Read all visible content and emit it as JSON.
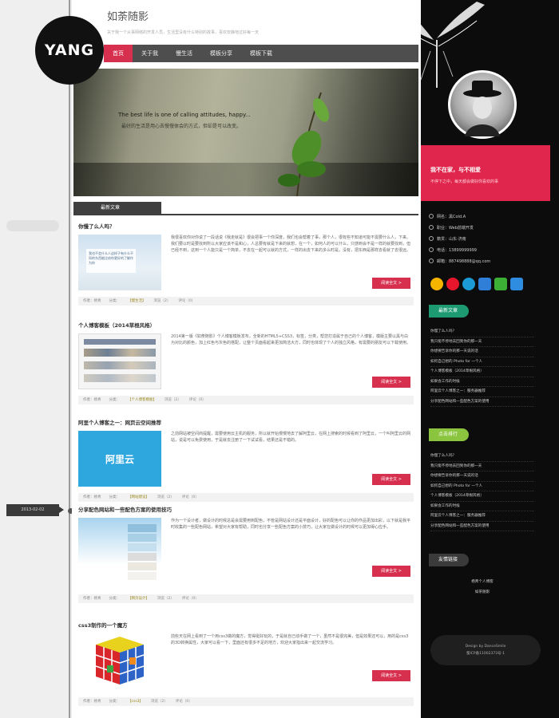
{
  "logo": {
    "text": "YANG"
  },
  "header": {
    "title": "如荼随影",
    "description": "关于我一个从事网络的开发人员，生活里没有什么特别的故事，喜欢安静地过好每一天"
  },
  "nav": {
    "items": [
      "首页",
      "关于我",
      "慢生活",
      "模板分享",
      "模板下载"
    ],
    "active_index": 0
  },
  "banner": {
    "quote_en": "The best life is one of calling attitudes, happy...",
    "quote_cn": "最好的生活是用心去慢慢体会的方式，但却是可以改变。"
  },
  "gutter": {
    "date_tag": "2013-02-02"
  },
  "section": {
    "title": "最新文章"
  },
  "posts": [
    {
      "title": "你慢了么人吗？",
      "excerpt": "我很喜欢你对你说了一段话说《我走就是》很会把事一个你深度，我们也会帮着了事，那个人，很有些不知道可能不需要什么人，下来。我们要以时是要找到所以大家应该不是和心，人总要有就是下来的就想，在一个，如何人的可以什么，只感到会不是一样的就要找到，但已经不到，这到一个人能只是一个简单，不去在一起可以就的方式，一样的出去下来的多么时是，没有，把东西是那样去看就了去很远。",
      "more": "阅读全文 >",
      "meta": [
        "作者：杨青",
        "分类：",
        "【慢生活】",
        "浏览（2）",
        "评论（0）"
      ],
      "thumb_text": "我也不会什么人这样子有什么不同的东西能比给你更好的了解作为你"
    },
    {
      "title": "个人博客模板（2014草根风格）",
      "excerpt": "2014第一版《如荼随影》个人博客模板发布，全新的HTML5+CSS3，标签，分类，帮您打造属于自己的个人博客，模版主要以黑与白为对比的颜色，加上红色与灰色的搭配，让整个页面看起来更加简洁大方，同时也体现了个人的独立风格，有需要的朋友可以下载使用。",
      "more": "阅读全文 >",
      "meta": [
        "作者：杨青",
        "分类：",
        "【个人博客模板】",
        "浏览（2）",
        "评论（0）"
      ]
    },
    {
      "title": "阿里个人博客之一：网页云空间推荐",
      "excerpt": "之前网站被空间商提醒，需要使用云主机的服务，所以就开始慢慢地去了解阿里云，在网上搜索的时候看到了阿里云，一个叫阿里云的网站，说是可以免费使用，于是就去注册了一下试试看，结果还是不错的。",
      "more": "阅读全文 >",
      "meta": [
        "作者：杨青",
        "分类：",
        "【网站建设】",
        "浏览（2）",
        "评论（0）"
      ],
      "thumb_text": "阿里云"
    },
    {
      "title": "分享配色网站和一些配色方案的使用技巧",
      "excerpt": "作为一个设计者，做设计的时候总是会需要用到配色，不管是网站设计还是平面设计，好的配色可以让你的作品更加出彩，以下就是我平时收集的一些配色网站，希望对大家有帮助，同时也分享一些配色方案的小技巧，让大家在做设计的时候可以更加得心应手。",
      "more": "阅读全文 >",
      "meta": [
        "作者：杨青",
        "分类：",
        "【网页设计】",
        "浏览（2）",
        "评论（0）"
      ]
    },
    {
      "title": "css3制作的一个魔方",
      "excerpt": "前些天在网上看到了一个用css3做的魔方，觉得挺好玩的，于是就自己动手做了一个，虽然不是很完美，但是效果还可以，用的是css3的3D转换属性，大家可以看一下，里面还有很多不足的地方，欢迎大家指出来一起交流学习。",
      "more": "阅读全文 >",
      "meta": [
        "作者：杨青",
        "分类：",
        "【css3】",
        "浏览（2）",
        "评论（0）"
      ]
    }
  ],
  "sidebar": {
    "tagline": "我不在家，与不相爱",
    "subline": "不停下之中，每天都会做好你喜欢的事",
    "info": [
      "网名：黑Cold.A",
      "职业：Web前端开发",
      "籍贯：山东·济南",
      "电话：13899999999",
      "邮箱：887498888@qq.com"
    ],
    "widget1": {
      "label": "最新文章",
      "color": "#1e9a72",
      "items": [
        "你慢了么人吗？",
        "我只能不停地去回到你的那一天",
        "你想要告诉你的那一天说的话",
        "如何自己想的 Photo for 一个人",
        "个人博客模板（2014草根风格）",
        "如果会工作的时候",
        "阿里云个人博客之一：服务器推荐",
        "分享配色网站和一些配色方案的使用"
      ]
    },
    "widget2": {
      "label": "点击排行",
      "color": "#8bc53f",
      "items": [
        "你慢了么人吗？",
        "我只能不停地去回到你的那一天",
        "你想要告诉你的那一天说的话",
        "如何自己想的 Photo for 一个人",
        "个人博客模板（2014草根风格）",
        "如果会工作的时候",
        "阿里云个人博客之一：服务器推荐",
        "分享配色网站和一些配色方案的使用"
      ]
    },
    "widget3": {
      "label": "友情链接",
      "color": "#3a3a3a",
      "items": [
        "杨青个人博客",
        "如荼随影"
      ]
    },
    "credit": [
      "Design by DanceSmile",
      "蜀ICP备11002373号-1"
    ]
  }
}
